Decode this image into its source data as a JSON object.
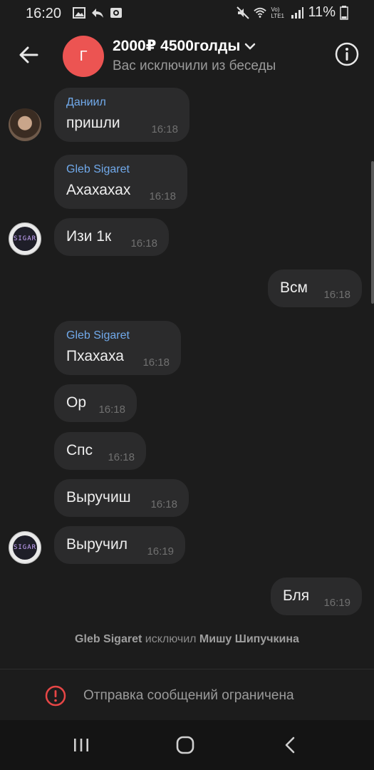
{
  "status_bar": {
    "time": "16:20",
    "battery": "11%",
    "lte": "Vo) LTE1"
  },
  "header": {
    "avatar_letter": "Г",
    "title": "2000₽ 4500голды",
    "subtitle": "Вас исключили из беседы"
  },
  "messages": [
    {
      "sender": "Даниил",
      "text": "пришли",
      "time": "16:18"
    },
    {
      "sender": "Gleb Sigaret",
      "text": "Ахахахах",
      "time": "16:18"
    },
    {
      "text": "Изи 1к",
      "time": "16:18"
    },
    {
      "text": "Всм",
      "time": "16:18"
    },
    {
      "sender": "Gleb Sigaret",
      "text": "Пхахаха",
      "time": "16:18"
    },
    {
      "text": "Ор",
      "time": "16:18"
    },
    {
      "text": "Спс",
      "time": "16:18"
    },
    {
      "text": "Выручиш",
      "time": "16:18"
    },
    {
      "text": "Выручил",
      "time": "16:19"
    },
    {
      "text": "Бля",
      "time": "16:19"
    }
  ],
  "avatars": {
    "sigar_label": "SIGAR"
  },
  "system_message": {
    "actor": "Gleb Sigaret",
    "action": "исключил",
    "target": "Мишу Шипучкина"
  },
  "restriction": {
    "text": "Отправка сообщений ограничена"
  },
  "colors": {
    "accent_name": "#71aaeb",
    "avatar_bg": "#ec5452",
    "bubble_bg": "#2b2b2c",
    "alert": "#e64646"
  },
  "icons": {
    "back": "arrow-left-icon",
    "info": "info-icon",
    "chevron": "chevron-down-icon",
    "alert": "alert-circle-icon",
    "nav_recent": "recent-apps-icon",
    "nav_home": "home-icon",
    "nav_back": "nav-back-icon"
  }
}
